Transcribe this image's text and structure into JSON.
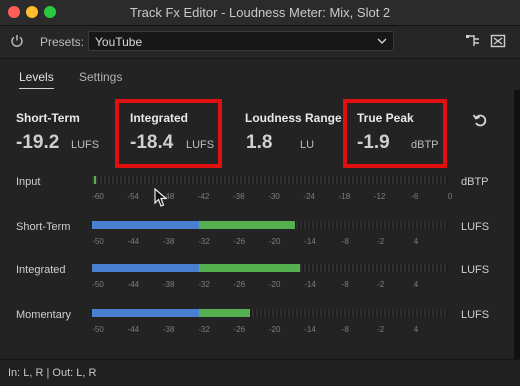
{
  "window": {
    "title": "Track Fx Editor - Loudness Meter: Mix, Slot 2"
  },
  "toolbar": {
    "presets_label": "Presets:",
    "preset_value": "YouTube"
  },
  "tabs": [
    {
      "label": "Levels",
      "active": true
    },
    {
      "label": "Settings",
      "active": false
    }
  ],
  "stats": {
    "short_term": {
      "label": "Short-Term",
      "value": "-19.2",
      "unit": "LUFS"
    },
    "integrated": {
      "label": "Integrated",
      "value": "-18.4",
      "unit": "LUFS"
    },
    "loudness_range": {
      "label": "Loudness Range",
      "value": "1.8",
      "unit": "LU"
    },
    "true_peak": {
      "label": "True Peak",
      "value": "-1.9",
      "unit": "dBTP"
    }
  },
  "meters": [
    {
      "label": "Input",
      "unit": "dBTP",
      "ticks": [
        "-60",
        "-54",
        "-48",
        "-42",
        "-36",
        "-30",
        "-24",
        "-18",
        "-12",
        "-6",
        "0"
      ],
      "blue_fraction": 0.0,
      "green_fraction": 0.0,
      "marker_fraction": 0.005
    },
    {
      "label": "Short-Term",
      "unit": "LUFS",
      "ticks": [
        "-50",
        "-44",
        "-38",
        "-32",
        "-26",
        "-20",
        "-14",
        "-8",
        "-2",
        "4"
      ],
      "blue_fraction": 0.3,
      "green_fraction": 0.57
    },
    {
      "label": "Integrated",
      "unit": "LUFS",
      "ticks": [
        "-50",
        "-44",
        "-38",
        "-32",
        "-26",
        "-20",
        "-14",
        "-8",
        "-2",
        "4"
      ],
      "blue_fraction": 0.3,
      "green_fraction": 0.585
    },
    {
      "label": "Momentary",
      "unit": "LUFS",
      "ticks": [
        "-50",
        "-44",
        "-38",
        "-32",
        "-26",
        "-20",
        "-14",
        "-8",
        "-2",
        "4"
      ],
      "blue_fraction": 0.3,
      "green_fraction": 0.445
    }
  ],
  "status": {
    "text": "In: L, R | Out: L, R"
  },
  "colors": {
    "highlight": "#e01010",
    "meter_blue": "#4a7fd0",
    "meter_green": "#56b04f"
  },
  "icons": {
    "power": "power-icon",
    "reset": "reset-icon",
    "routing": "routing-icon",
    "collapse": "collapse-icon",
    "chevron": "chevron-down-icon",
    "cursor": "mouse-cursor"
  }
}
